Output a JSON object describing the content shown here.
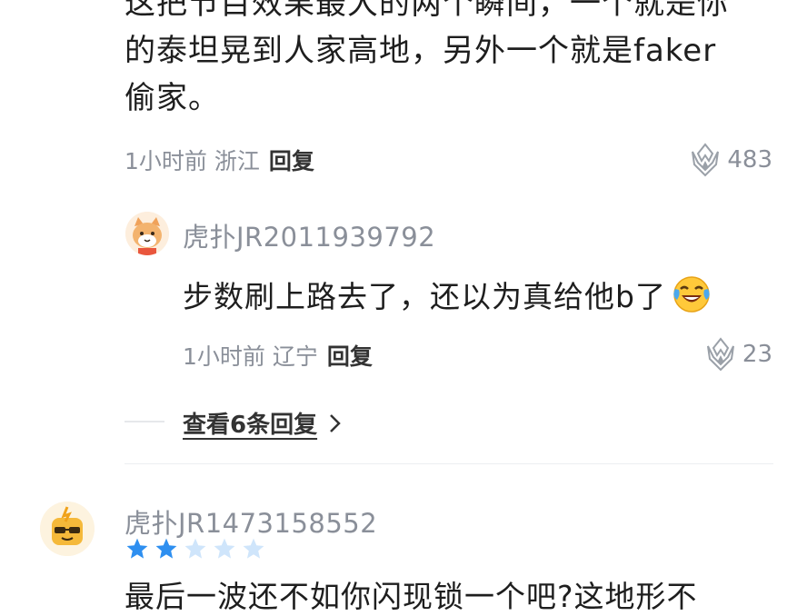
{
  "comment1": {
    "text_lines": [
      "这把节目效果最大的两个瞬间，一个就是你",
      "的泰坦晃到人家高地，另外一个就是faker",
      "偷家。"
    ],
    "time": "1小时前",
    "location": "浙江",
    "reply_label": "回复",
    "likes": "483"
  },
  "reply1": {
    "username": "虎扑JR2011939792",
    "text": "步数刷上路去了，还以为真给他b了",
    "emoji": "laughing-crying-emoji",
    "time": "1小时前",
    "location": "辽宁",
    "reply_label": "回复",
    "likes": "23"
  },
  "view_more": {
    "label": "查看6条回复"
  },
  "comment2": {
    "username": "虎扑JR1473158552",
    "rating": 2,
    "rating_max": 5,
    "text": "最后一波还不如你闪现锁一个吧?这地形不"
  },
  "colors": {
    "star_filled": "#2e8ff0",
    "star_empty": "#cfe5fb",
    "meta_gray": "#8a8f99"
  }
}
